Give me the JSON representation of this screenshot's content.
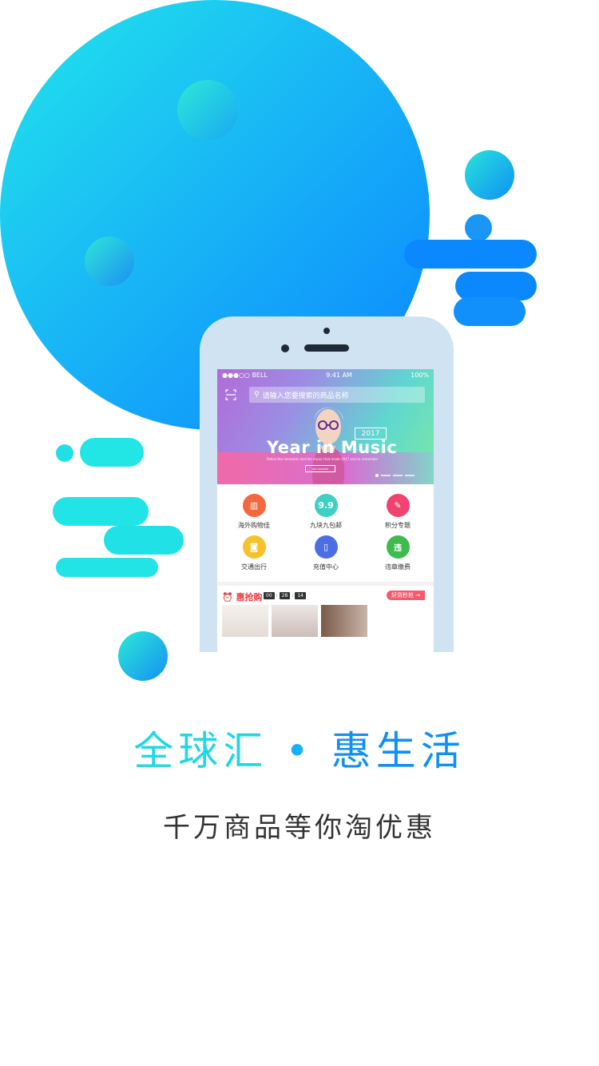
{
  "phone": {
    "status": {
      "carrier": "●●●○○ BELL",
      "time": "9:41 AM",
      "battery": "100%"
    },
    "search": {
      "placeholder": "请输入您要搜索的商品名称"
    },
    "banner": {
      "year": "2017",
      "title": "Year in Music",
      "subtitle": "Relive the moments and the music that made 2017 one to remember",
      "button": "GET STARTED"
    },
    "categories": [
      {
        "label": "海外购物佳",
        "icon": "building-icon",
        "color": "#f5673c",
        "glyph": "▥"
      },
      {
        "label": "九块九包邮",
        "icon": "nine-nine-icon",
        "color": "#3fd0c4",
        "glyph": "9.9"
      },
      {
        "label": "积分专题",
        "icon": "points-icon",
        "color": "#f1436f",
        "glyph": "✎"
      },
      {
        "label": "交通出行",
        "icon": "camera-icon",
        "color": "#f7c12b",
        "glyph": "◙"
      },
      {
        "label": "充值中心",
        "icon": "mobile-icon",
        "color": "#4c6ee4",
        "glyph": "▯"
      },
      {
        "label": "违章缴费",
        "icon": "fine-icon",
        "color": "#3dbb4e",
        "glyph": "违"
      }
    ],
    "flash_sale": {
      "logo": "⏰ 惠抢购",
      "timer": [
        "00",
        "28",
        "14"
      ],
      "more": "好货秒抢 →"
    }
  },
  "slogan": {
    "part1": "全球汇",
    "dot": "•",
    "part2": "惠生活"
  },
  "tagline": "千万商品等你淘优惠",
  "colors": {
    "brand_cyan": "#1ed9e0",
    "brand_blue": "#1190f2"
  }
}
